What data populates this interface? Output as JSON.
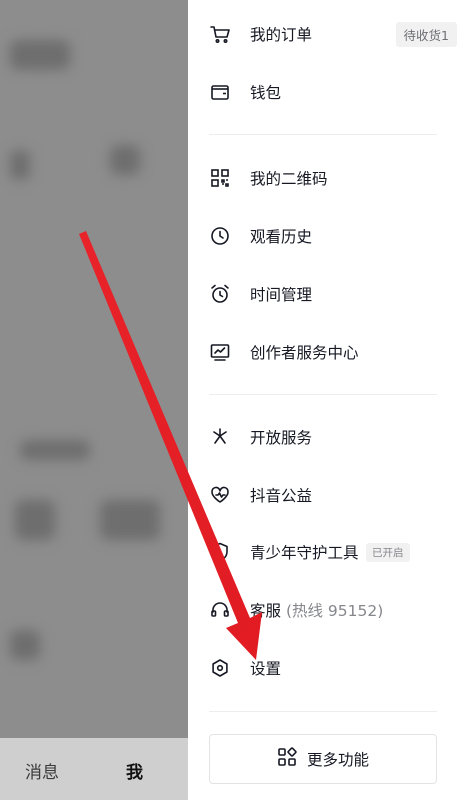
{
  "background": {
    "tabs": [
      {
        "label": "消息",
        "active": false
      },
      {
        "label": "我",
        "active": true
      }
    ]
  },
  "drawer": {
    "items": [
      {
        "label": "我的订单",
        "icon": "cart-icon",
        "badge": "待收货1"
      },
      {
        "label": "钱包",
        "icon": "wallet-icon"
      },
      {
        "label": "我的二维码",
        "icon": "qr-code-icon"
      },
      {
        "label": "观看历史",
        "icon": "clock-icon"
      },
      {
        "label": "时间管理",
        "icon": "alarm-clock-icon"
      },
      {
        "label": "创作者服务中心",
        "icon": "creator-chart-icon"
      },
      {
        "label": "开放服务",
        "icon": "open-service-icon"
      },
      {
        "label": "抖音公益",
        "icon": "charity-heart-icon"
      },
      {
        "label": "青少年守护工具",
        "icon": "youth-shield-icon",
        "badge": "已开启"
      },
      {
        "label": "客服",
        "suffix": "(热线 95152)",
        "icon": "headset-icon"
      },
      {
        "label": "设置",
        "icon": "settings-icon"
      }
    ],
    "more_button": {
      "label": "更多功能",
      "icon": "grid-icon"
    }
  },
  "annotation": {
    "color": "#e8232a",
    "type": "arrow pointing to settings"
  }
}
